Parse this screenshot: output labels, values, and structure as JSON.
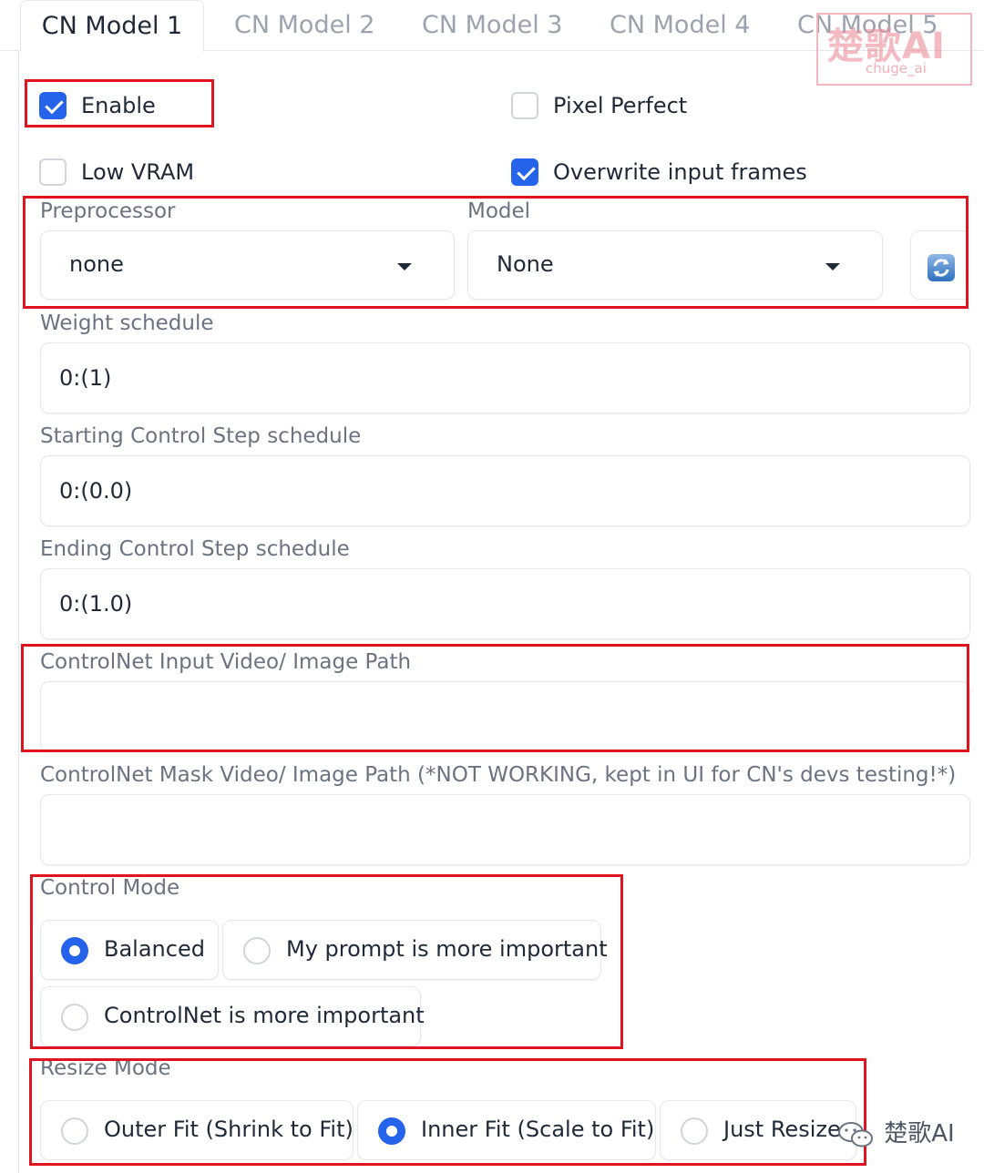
{
  "tabs": [
    {
      "label": "CN Model 1",
      "active": true
    },
    {
      "label": "CN Model 2",
      "active": false
    },
    {
      "label": "CN Model 3",
      "active": false
    },
    {
      "label": "CN Model 4",
      "active": false
    },
    {
      "label": "CN Model 5",
      "active": false
    }
  ],
  "checkboxes": {
    "enable": {
      "label": "Enable",
      "checked": true
    },
    "pixel_perfect": {
      "label": "Pixel Perfect",
      "checked": false
    },
    "low_vram": {
      "label": "Low VRAM",
      "checked": false
    },
    "overwrite_input_frames": {
      "label": "Overwrite input frames",
      "checked": true
    }
  },
  "preprocessor": {
    "label": "Preprocessor",
    "value": "none"
  },
  "model": {
    "label": "Model",
    "value": "None"
  },
  "icons": {
    "refresh": "refresh-icon",
    "dropdown": "caret-down-icon"
  },
  "weight_schedule": {
    "label": "Weight schedule",
    "value": "0:(1)"
  },
  "starting_control_step": {
    "label": "Starting Control Step schedule",
    "value": "0:(0.0)"
  },
  "ending_control_step": {
    "label": "Ending Control Step schedule",
    "value": "0:(1.0)"
  },
  "input_path": {
    "label": "ControlNet Input Video/ Image Path",
    "value": ""
  },
  "mask_path": {
    "label": "ControlNet Mask Video/ Image Path (*NOT WORKING, kept in UI for CN's devs testing!*)",
    "value": ""
  },
  "control_mode": {
    "label": "Control Mode",
    "options": [
      "Balanced",
      "My prompt is more important",
      "ControlNet is more important"
    ],
    "selected": "Balanced"
  },
  "resize_mode": {
    "label": "Resize Mode",
    "options": [
      "Outer Fit (Shrink to Fit)",
      "Inner Fit (Scale to Fit)",
      "Just Resize"
    ],
    "selected": "Inner Fit (Scale to Fit)"
  },
  "watermark": {
    "top_main": "楚歌AI",
    "top_sub": "chuge_ai",
    "bottom": "楚歌AI"
  },
  "colors": {
    "accent": "#2563eb",
    "annotation": "#e0141e",
    "border": "#e5e7eb",
    "muted_text": "#6b7280"
  }
}
